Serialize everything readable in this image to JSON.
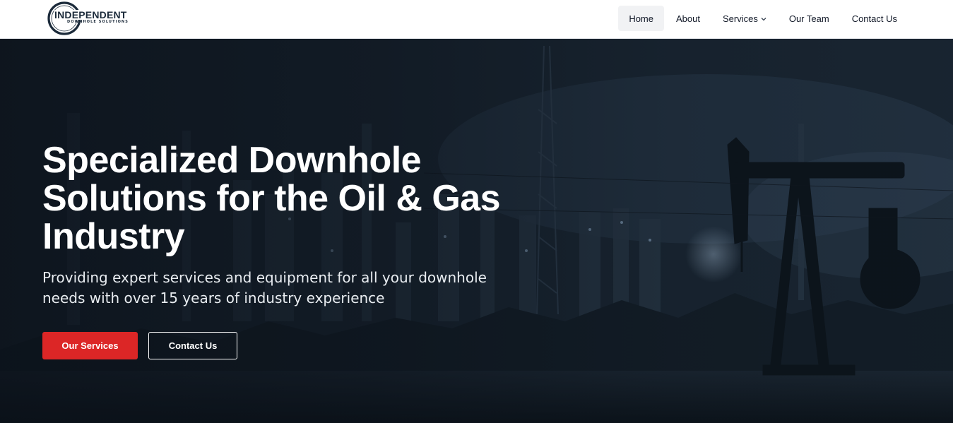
{
  "brand": {
    "name": "INDEPENDENT",
    "tagline": "DOWNHOLE SOLUTIONS",
    "colors": {
      "navy": "#1b2a3a",
      "accent": "#dc2626"
    }
  },
  "nav": {
    "items": [
      {
        "label": "Home",
        "active": true
      },
      {
        "label": "About",
        "active": false
      },
      {
        "label": "Services",
        "active": false,
        "has_dropdown": true
      },
      {
        "label": "Our Team",
        "active": false
      },
      {
        "label": "Contact Us",
        "active": false
      }
    ],
    "dropdown_icon": "chevron-down-icon"
  },
  "hero": {
    "title_line1": "Specialized Downhole",
    "title_line2": "Solutions for the Oil & Gas",
    "title_line3": "Industry",
    "subtitle_line1": "Providing expert services and equipment for all your downhole",
    "subtitle_line2": "needs with over 15 years of industry experience",
    "primary_button": "Our Services",
    "secondary_button": "Contact Us",
    "background_description_icon": "oil-field-night-image"
  }
}
